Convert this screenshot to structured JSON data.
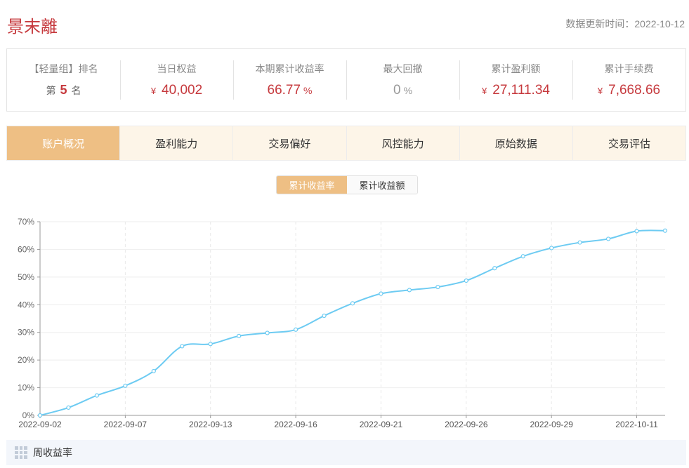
{
  "header": {
    "title": "景末離",
    "update_time": "数据更新时间：2022-10-12"
  },
  "stats": {
    "rank": {
      "label": "【轻量组】排名",
      "prefix": "第",
      "value": "5",
      "suffix": "名"
    },
    "daily_equity": {
      "label": "当日权益",
      "currency": "¥",
      "value": "40,002"
    },
    "period_return": {
      "label": "本期累计收益率",
      "value": "66.77",
      "unit": "%"
    },
    "max_drawdown": {
      "label": "最大回撤",
      "value": "0",
      "unit": "%"
    },
    "total_profit": {
      "label": "累计盈利额",
      "currency": "¥",
      "value": "27,111.34"
    },
    "total_fees": {
      "label": "累计手续费",
      "currency": "¥",
      "value": "7,668.66"
    }
  },
  "tabs": [
    {
      "label": "账户概况",
      "active": true
    },
    {
      "label": "盈利能力",
      "active": false
    },
    {
      "label": "交易偏好",
      "active": false
    },
    {
      "label": "风控能力",
      "active": false
    },
    {
      "label": "原始数据",
      "active": false
    },
    {
      "label": "交易评估",
      "active": false
    }
  ],
  "chart_toggle": {
    "options": [
      "累计收益率",
      "累计收益额"
    ],
    "selected": "累计收益率"
  },
  "chart_data": {
    "type": "line",
    "x": [
      "2022-09-02",
      "2022-09-05",
      "2022-09-06",
      "2022-09-07",
      "2022-09-08",
      "2022-09-09",
      "2022-09-13",
      "2022-09-14",
      "2022-09-15",
      "2022-09-16",
      "2022-09-19",
      "2022-09-20",
      "2022-09-21",
      "2022-09-22",
      "2022-09-23",
      "2022-09-26",
      "2022-09-27",
      "2022-09-28",
      "2022-09-29",
      "2022-09-30",
      "2022-10-10",
      "2022-10-11",
      "2022-10-12"
    ],
    "series": [
      {
        "values": [
          0,
          2.8,
          7.2,
          10.7,
          16,
          25,
          25.8,
          28.7,
          29.8,
          31,
          36,
          40.5,
          44,
          45.3,
          46.4,
          48.7,
          53.2,
          57.5,
          60.5,
          62.5,
          63.8,
          66.6,
          66.77
        ],
        "color": "#6dcbf2"
      }
    ],
    "x_tick_labels": [
      "2022-09-02",
      "2022-09-07",
      "2022-09-13",
      "2022-09-16",
      "2022-09-21",
      "2022-09-26",
      "2022-09-29",
      "2022-10-11"
    ],
    "y_tick_labels": [
      "0%",
      "10%",
      "20%",
      "30%",
      "40%",
      "50%",
      "60%",
      "70%"
    ],
    "ylim": [
      0,
      70
    ],
    "grid": true
  },
  "weekly": {
    "label": "周收益率",
    "icon": "grid-icon"
  }
}
